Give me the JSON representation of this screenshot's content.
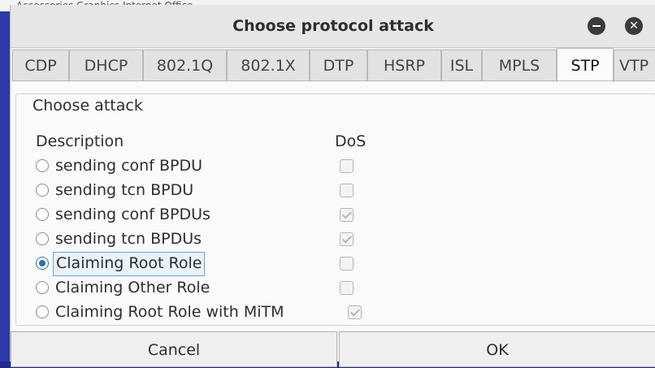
{
  "behind_text": "Accessories   Graphics   Internet   Office",
  "window": {
    "title": "Choose protocol attack",
    "minimize_icon": "minimize-icon",
    "close_icon": "close-icon",
    "close_glyph": "✕"
  },
  "tabs": [
    {
      "label": "CDP"
    },
    {
      "label": "DHCP"
    },
    {
      "label": "802.1Q"
    },
    {
      "label": "802.1X"
    },
    {
      "label": "DTP"
    },
    {
      "label": "HSRP"
    },
    {
      "label": "ISL"
    },
    {
      "label": "MPLS"
    },
    {
      "label": "STP",
      "active": true
    },
    {
      "label": "VTP"
    }
  ],
  "group": {
    "legend": "Choose attack",
    "description_header": "Description",
    "dos_header": "DoS"
  },
  "attacks": [
    {
      "label": "sending conf BPDU",
      "selected": false,
      "dos": false
    },
    {
      "label": "sending tcn BPDU",
      "selected": false,
      "dos": false
    },
    {
      "label": "sending conf BPDUs",
      "selected": false,
      "dos": true
    },
    {
      "label": "sending tcn BPDUs",
      "selected": false,
      "dos": true
    },
    {
      "label": "Claiming Root Role",
      "selected": true,
      "dos": false
    },
    {
      "label": "Claiming Other Role",
      "selected": false,
      "dos": false
    },
    {
      "label": "Claiming Root Role with MiTM",
      "selected": false,
      "dos": true
    }
  ],
  "buttons": {
    "cancel_label": "Cancel",
    "ok_label": "OK"
  },
  "colors": {
    "accent": "#2d6fa8",
    "desktop": "#1e2a8a"
  }
}
